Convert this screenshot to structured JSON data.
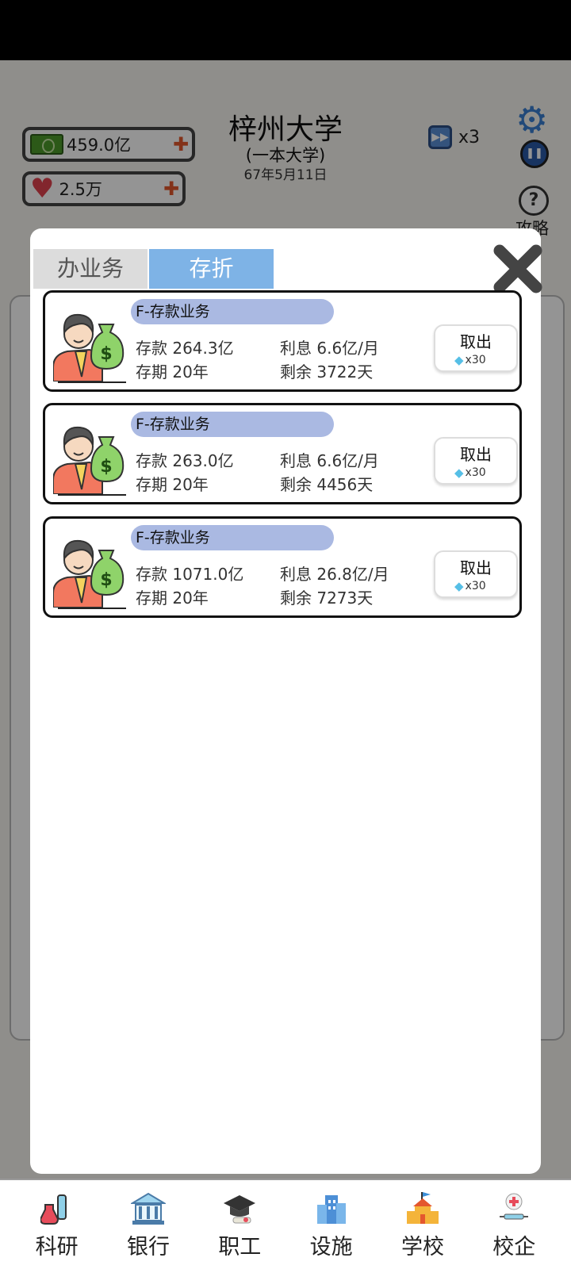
{
  "header": {
    "money": "459.0亿",
    "reputation": "2.5万",
    "school_name": "梓州大学",
    "school_tier": "(一本大学)",
    "date": "67年5月11日",
    "speed": "x3",
    "help_label": "攻略"
  },
  "modal": {
    "tabs": [
      {
        "label": "办业务",
        "active": false
      },
      {
        "label": "存折",
        "active": true
      }
    ],
    "deposits": [
      {
        "title": "F-存款业务",
        "amount": "存款 264.3亿",
        "interest": "利息 6.6亿/月",
        "term": "存期 20年",
        "remaining": "剩余 3722天",
        "button": "取出",
        "cost": "x30"
      },
      {
        "title": "F-存款业务",
        "amount": "存款 263.0亿",
        "interest": "利息 6.6亿/月",
        "term": "存期 20年",
        "remaining": "剩余 4456天",
        "button": "取出",
        "cost": "x30"
      },
      {
        "title": "F-存款业务",
        "amount": "存款 1071.0亿",
        "interest": "利息 26.8亿/月",
        "term": "存期 20年",
        "remaining": "剩余 7273天",
        "button": "取出",
        "cost": "x30"
      }
    ]
  },
  "bottom_nav": [
    {
      "label": "科研",
      "icon": "flask-icon"
    },
    {
      "label": "银行",
      "icon": "bank-icon"
    },
    {
      "label": "职工",
      "icon": "graduation-cap-icon"
    },
    {
      "label": "设施",
      "icon": "building-icon"
    },
    {
      "label": "学校",
      "icon": "school-icon"
    },
    {
      "label": "校企",
      "icon": "medical-icon"
    }
  ],
  "colors": {
    "tab_active": "#7eb3e6",
    "tag": "#aab9e2",
    "overlay": "rgba(0,0,0,0.42)"
  }
}
